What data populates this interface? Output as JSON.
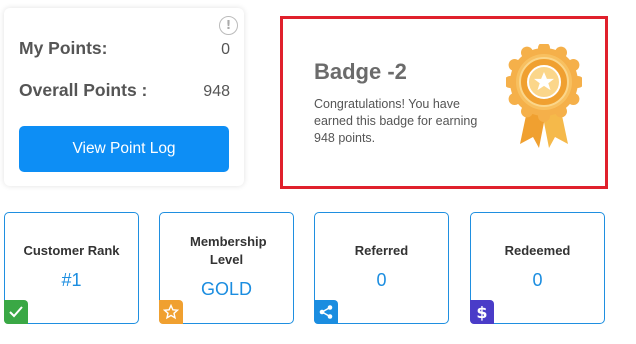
{
  "points": {
    "my_points_label": "My Points:",
    "my_points_value": "0",
    "overall_points_label": "Overall Points :",
    "overall_points_value": "948",
    "view_log_label": "View Point Log",
    "info_icon": "info-icon"
  },
  "badge": {
    "title": "Badge -2",
    "description": "Congratulations! You have earned this badge for earning 948 points.",
    "icon": "medal-icon"
  },
  "stats": [
    {
      "label": "Customer Rank",
      "value": "#1",
      "icon": "check-icon",
      "color": "#3aa845"
    },
    {
      "label": "Membership Level",
      "value": "GOLD",
      "icon": "star-icon",
      "color": "#f0a030"
    },
    {
      "label": "Referred",
      "value": "0",
      "icon": "share-icon",
      "color": "#1b8de0"
    },
    {
      "label": "Redeemed",
      "value": "0",
      "icon": "dollar-icon",
      "color": "#4a3cc8"
    }
  ],
  "colors": {
    "primary": "#0d8ef5",
    "highlight_border": "#e0202c",
    "stat_value": "#1b8de0"
  }
}
